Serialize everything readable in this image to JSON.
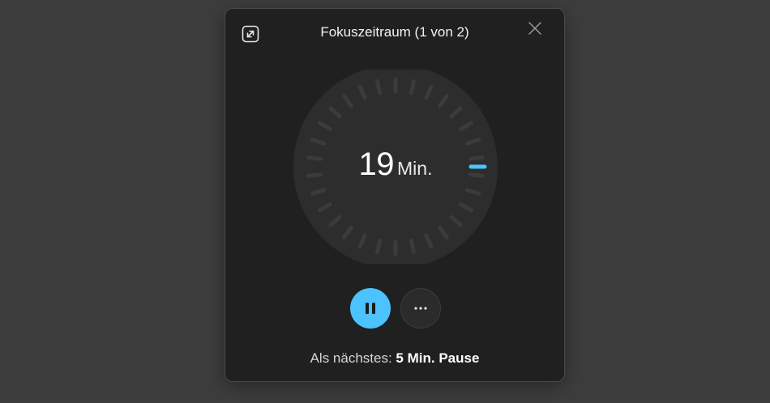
{
  "window": {
    "title": "Fokuszeitraum (1 von 2)"
  },
  "timer": {
    "value": "19",
    "unit": "Min.",
    "tick_count": 30,
    "progress_fraction": 0.0,
    "colors": {
      "track": "#2d2d2d",
      "tick": "#3b3b3b",
      "indicator": "#4cc2ff"
    }
  },
  "controls": {
    "pause_icon": "pause-icon",
    "more_icon": "more-icon",
    "expand_icon": "expand-icon",
    "close_icon": "close-icon"
  },
  "next": {
    "label": "Als nächstes:",
    "value": "5 Min. Pause"
  },
  "colors": {
    "accent": "#4cc2ff",
    "panel": "#202020",
    "background": "#3d3d3d"
  }
}
